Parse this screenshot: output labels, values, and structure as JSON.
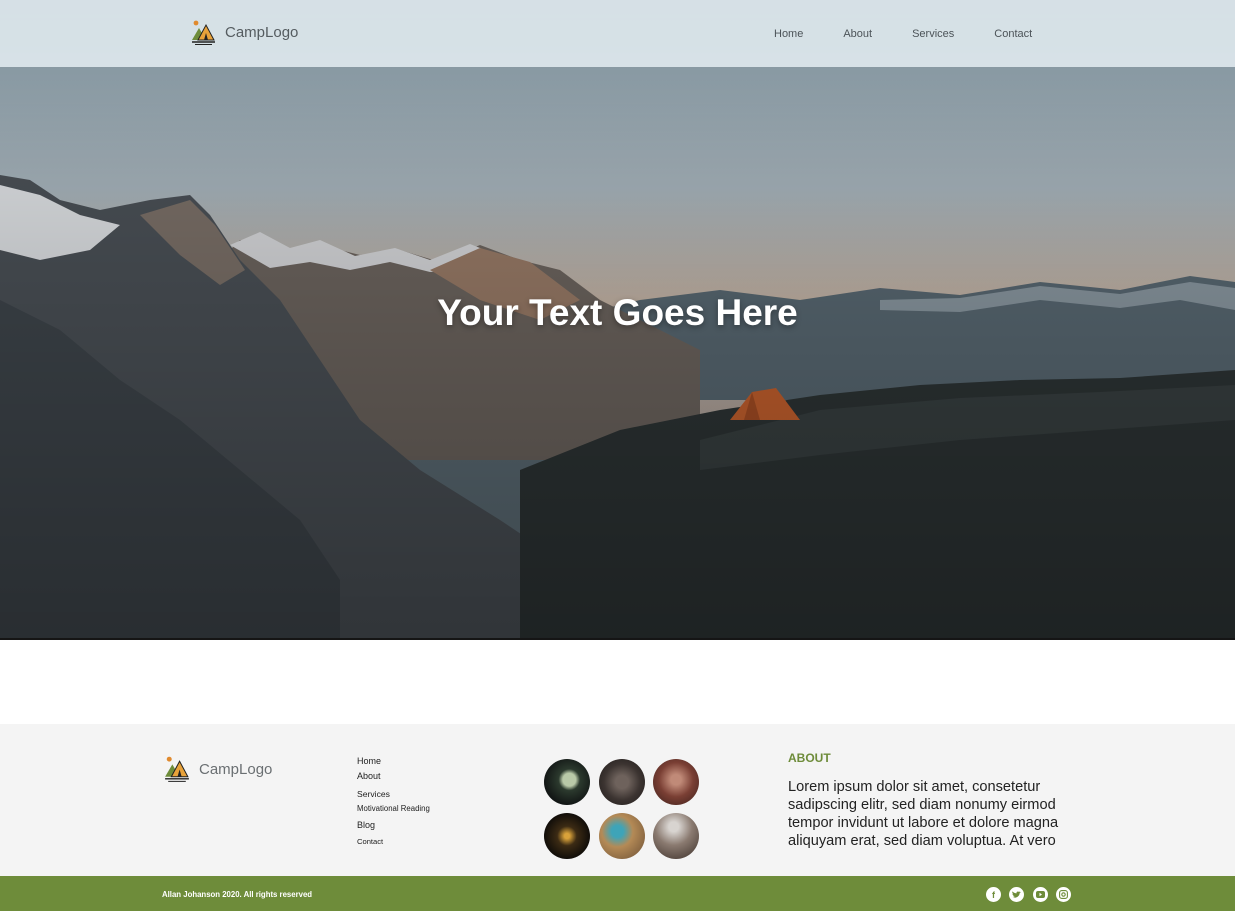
{
  "header": {
    "logo_text": "CampLogo",
    "nav": [
      "Home",
      "About",
      "Services",
      "Contact"
    ]
  },
  "hero": {
    "title": "Your Text Goes Here"
  },
  "footer": {
    "logo_text": "CampLogo",
    "links": [
      "Home",
      "About",
      "Services",
      "Motivational Reading",
      "Blog",
      "Contact"
    ],
    "about_heading": "ABOUT",
    "about_text": "Lorem ipsum dolor sit amet, consetetur sadipscing elitr, sed diam nonumy eirmod tempor invidunt ut labore et dolore magna aliquyam erat, sed diam voluptua. At vero",
    "copyright": "Allan Johanson 2020. All rights reserved",
    "socials": [
      "facebook-icon",
      "twitter-icon",
      "youtube-icon",
      "instagram-icon"
    ]
  },
  "colors": {
    "accent": "#6e8c3a",
    "topbar": "#dde6ec",
    "footer_bg": "#f4f4f4"
  }
}
